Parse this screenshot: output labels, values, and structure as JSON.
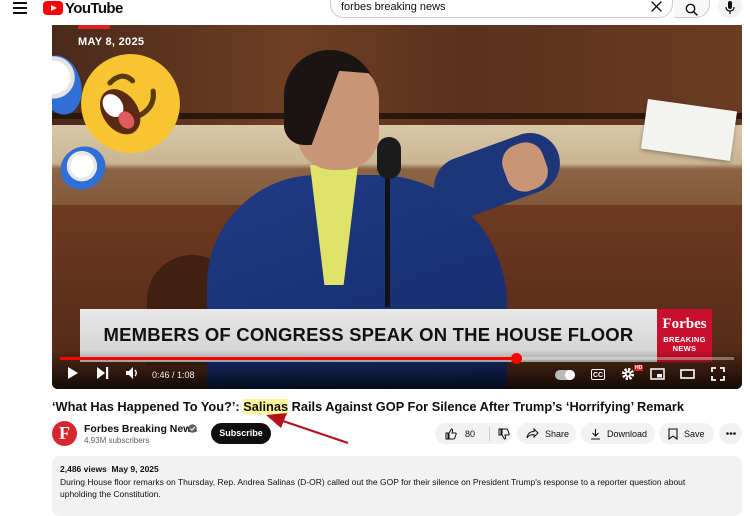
{
  "header": {
    "logo_text": "YouTube",
    "search_value": "forbes breaking news"
  },
  "player": {
    "date_stamp": "MAY 8, 2025",
    "lower_third": "MEMBERS OF CONGRESS SPEAK ON THE HOUSE FLOOR",
    "bug_title": "Forbes",
    "bug_sub1": "BREAKING",
    "bug_sub2": "NEWS",
    "time": "0:46 / 1:08",
    "progress_fraction": 0.677,
    "cc_label": "CC",
    "hd_label": "HD"
  },
  "video": {
    "title_before": "‘What Has Happened To You?’: ",
    "title_highlight": "Salinas",
    "title_after": " Rails Against GOP For Silence After Trump’s ‘Horrifying’ Remark"
  },
  "channel": {
    "logo_letter": "F",
    "name": "Forbes Breaking News",
    "subscribers": "4.93M subscribers",
    "subscribe_label": "Subscribe"
  },
  "actions": {
    "like_count": "80",
    "share_label": "Share",
    "download_label": "Download",
    "save_label": "Save"
  },
  "description": {
    "meta": "2,486 views  May 9, 2025",
    "line1": "During House floor remarks on Thursday, Rep. Andrea Salinas (D-OR) called out the GOP for their silence on President Trump's response to a reporter question about",
    "line2": "upholding the Constitution."
  },
  "colors": {
    "brand_red": "#ff0000",
    "forbes_red": "#c8102e",
    "highlight": "#fff59a",
    "annotation_arrow": "#b3111b"
  }
}
